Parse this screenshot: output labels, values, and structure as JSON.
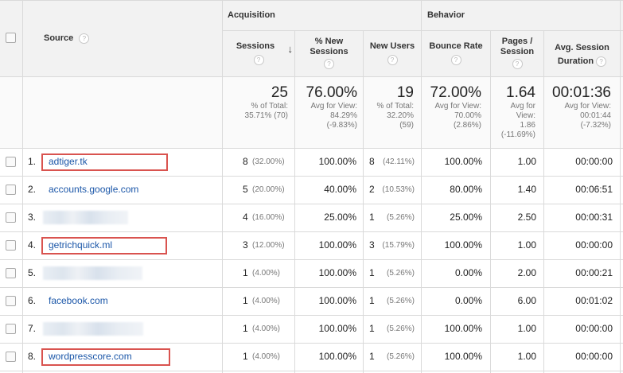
{
  "groups": {
    "acquisition": "Acquisition",
    "behavior": "Behavior"
  },
  "columns": {
    "source": "Source",
    "sessions": "Sessions",
    "new_sessions_pct": "% New Sessions",
    "new_users": "New Users",
    "bounce_rate": "Bounce Rate",
    "pages_per_session": "Pages / Session",
    "avg_session_duration": "Avg. Session Duration"
  },
  "icons": {
    "help": "help-icon",
    "sort": "sort-arrow-down-icon",
    "checkbox": "checkbox-icon"
  },
  "totals": {
    "sessions": {
      "value": "25",
      "line1": "% of Total:",
      "line2": "35.71% (70)"
    },
    "new_sessions_pct": {
      "value": "76.00%",
      "line1": "Avg for View:",
      "line2": "84.29%",
      "line3": "(-9.83%)"
    },
    "new_users": {
      "value": "19",
      "line1": "% of Total:",
      "line2": "32.20%",
      "line3": "(59)"
    },
    "bounce_rate": {
      "value": "72.00%",
      "line1": "Avg for View:",
      "line2": "70.00%",
      "line3": "(2.86%)"
    },
    "pages_per_session": {
      "value": "1.64",
      "line1": "Avg for",
      "line2": "View:",
      "line3": "1.86",
      "line4": "(-11.69%)"
    },
    "avg_session_duration": {
      "value": "00:01:36",
      "line1": "Avg for View:",
      "line2": "00:01:44",
      "line3": "(-7.32%)"
    }
  },
  "rows": [
    {
      "index": "1.",
      "source": "adtiger.tk",
      "sessions": "8",
      "sessions_pct": "(32.00%)",
      "new_sessions_pct": "100.00%",
      "new_users": "8",
      "new_users_pct": "(42.11%)",
      "bounce_rate": "100.00%",
      "pages_per_session": "1.00",
      "avg_session_duration": "00:00:00"
    },
    {
      "index": "2.",
      "source": "accounts.google.com",
      "sessions": "5",
      "sessions_pct": "(20.00%)",
      "new_sessions_pct": "40.00%",
      "new_users": "2",
      "new_users_pct": "(10.53%)",
      "bounce_rate": "80.00%",
      "pages_per_session": "1.40",
      "avg_session_duration": "00:06:51"
    },
    {
      "index": "3.",
      "source": "",
      "sessions": "4",
      "sessions_pct": "(16.00%)",
      "new_sessions_pct": "25.00%",
      "new_users": "1",
      "new_users_pct": "(5.26%)",
      "bounce_rate": "25.00%",
      "pages_per_session": "2.50",
      "avg_session_duration": "00:00:31"
    },
    {
      "index": "4.",
      "source": "getrichquick.ml",
      "sessions": "3",
      "sessions_pct": "(12.00%)",
      "new_sessions_pct": "100.00%",
      "new_users": "3",
      "new_users_pct": "(15.79%)",
      "bounce_rate": "100.00%",
      "pages_per_session": "1.00",
      "avg_session_duration": "00:00:00"
    },
    {
      "index": "5.",
      "source": "",
      "sessions": "1",
      "sessions_pct": "(4.00%)",
      "new_sessions_pct": "100.00%",
      "new_users": "1",
      "new_users_pct": "(5.26%)",
      "bounce_rate": "0.00%",
      "pages_per_session": "2.00",
      "avg_session_duration": "00:00:21"
    },
    {
      "index": "6.",
      "source": "facebook.com",
      "sessions": "1",
      "sessions_pct": "(4.00%)",
      "new_sessions_pct": "100.00%",
      "new_users": "1",
      "new_users_pct": "(5.26%)",
      "bounce_rate": "0.00%",
      "pages_per_session": "6.00",
      "avg_session_duration": "00:01:02"
    },
    {
      "index": "7.",
      "source": "",
      "sessions": "1",
      "sessions_pct": "(4.00%)",
      "new_sessions_pct": "100.00%",
      "new_users": "1",
      "new_users_pct": "(5.26%)",
      "bounce_rate": "100.00%",
      "pages_per_session": "1.00",
      "avg_session_duration": "00:00:00"
    },
    {
      "index": "8.",
      "source": "wordpresscore.com",
      "sessions": "1",
      "sessions_pct": "(4.00%)",
      "new_sessions_pct": "100.00%",
      "new_users": "1",
      "new_users_pct": "(5.26%)",
      "bounce_rate": "100.00%",
      "pages_per_session": "1.00",
      "avg_session_duration": "00:00:00"
    }
  ],
  "highlight_color": "#d9534f",
  "link_color": "#1a56a8"
}
